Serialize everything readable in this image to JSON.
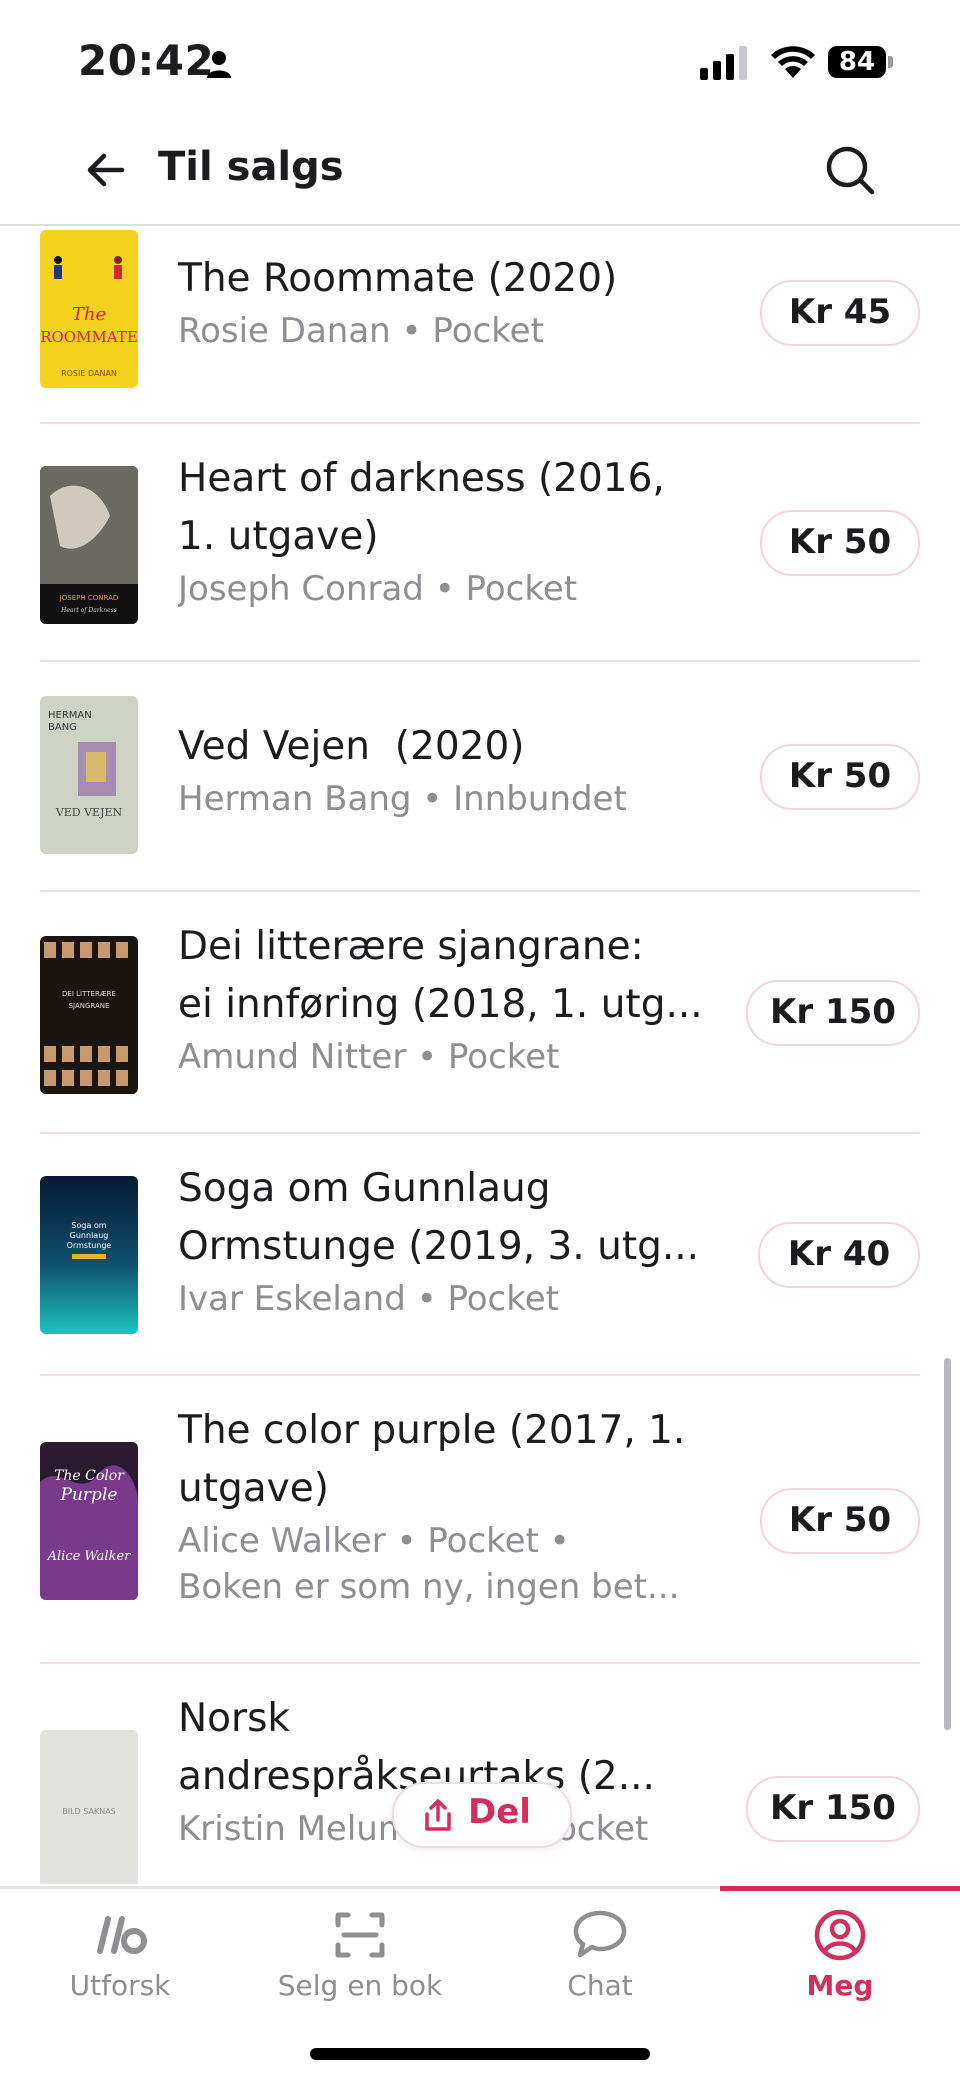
{
  "status_bar": {
    "time": "20:42",
    "battery": "84"
  },
  "header": {
    "title": "Til salgs"
  },
  "books": [
    {
      "title": "The Roommate (2020)",
      "meta": "Rosie Danan • Pocket",
      "price": "Kr 45",
      "cover_text": "The ROOMMATE",
      "cover_author": "ROSIE DANAN"
    },
    {
      "title_lines": [
        "Heart of darkness (2016,",
        "1. utgave)"
      ],
      "meta": "Joseph Conrad • Pocket",
      "price": "Kr 50",
      "cover_text": "JOSEPH CONRAD"
    },
    {
      "title": "Ved Vejen  (2020)",
      "meta": "Herman Bang • Innbundet",
      "price": "Kr 50",
      "cover_text": "HERMAN BANG",
      "cover_sub": "VED VEJEN"
    },
    {
      "title_lines": [
        "Dei litterære sjangrane:",
        "ei innføring (2018, 1. utg..."
      ],
      "meta": "Amund Nitter • Pocket",
      "price": "Kr 150",
      "cover_text": "DEI LITTERÆRE SJANGRANE"
    },
    {
      "title_lines": [
        "Soga om Gunnlaug",
        "Ormstunge (2019, 3. utg..."
      ],
      "meta": "Ivar Eskeland • Pocket",
      "price": "Kr 40",
      "cover_text": "Soga om Gunnlaug Ormstunge"
    },
    {
      "title_lines": [
        "The color purple (2017, 1.",
        "utgave)"
      ],
      "meta": "Alice Walker • Pocket •",
      "meta2": "Boken er som ny, ingen bet...",
      "price": "Kr 50",
      "cover_text": "The Color Purple",
      "cover_author": "Alice Walker"
    },
    {
      "title_lines": [
        "Norsk",
        "andrespråkseurtaks (2..."
      ],
      "meta": "Kristin Melum Eide • Pocket",
      "price": "Kr 150",
      "cover_text": "BILD SAKNAS"
    }
  ],
  "share_button": {
    "label": "Del"
  },
  "tabs": [
    {
      "label": "Utforsk",
      "icon": "lb-logo-icon"
    },
    {
      "label": "Selg en bok",
      "icon": "scan-icon"
    },
    {
      "label": "Chat",
      "icon": "chat-bubble-icon"
    },
    {
      "label": "Meg",
      "icon": "profile-icon"
    }
  ],
  "colors": {
    "accent": "#d32f5e",
    "divider": "#f6dde4",
    "muted": "#8e8e93"
  }
}
